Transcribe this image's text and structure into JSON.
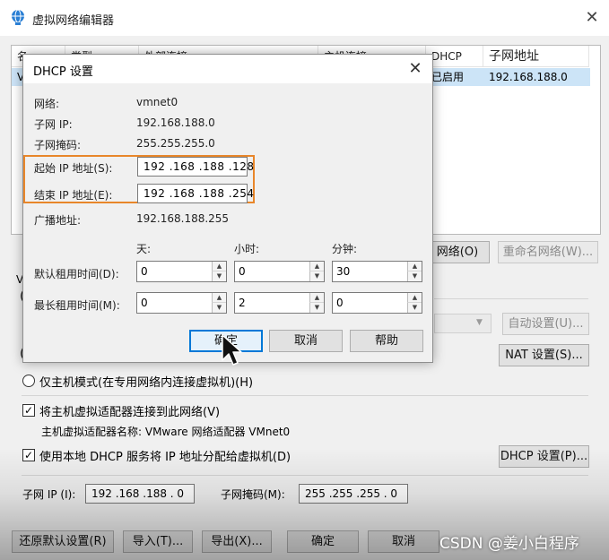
{
  "main_window": {
    "title": "虚拟网络编辑器",
    "close_glyph": "✕",
    "table": {
      "headers": [
        "名",
        "类型",
        "外部连接",
        "主机连接",
        "DHCP",
        "子网地址"
      ],
      "row": {
        "name": "V",
        "dhcp": "已启用",
        "subnet": "192.168.188.0"
      }
    },
    "buttons": {
      "add_network": "网络(O)",
      "rename_network": "重命名网络(W)...",
      "auto_settings": "自动设置(U)...",
      "nat_settings": "NAT 设置(S)...",
      "dhcp_settings": "DHCP 设置(P)...",
      "restore_defaults": "还原默认设置(R)",
      "import": "导入(T)...",
      "export": "导出(X)...",
      "ok": "确定",
      "cancel": "取消"
    },
    "left_partial": {
      "v": "V",
      "paren1": "(",
      "paren2": "("
    },
    "host_only_label": "仅主机模式(在专用网络内连接虚拟机)(H)",
    "connect_adapter_label": "将主机虚拟适配器连接到此网络(V)",
    "adapter_name_text": "主机虚拟适配器名称: VMware 网络适配器 VMnet0",
    "use_dhcp_label": "使用本地 DHCP 服务将 IP 地址分配给虚拟机(D)",
    "subnet_ip_label": "子网 IP (I):",
    "subnet_ip_value": "192 .168 .188 .  0",
    "subnet_mask_label": "子网掩码(M):",
    "subnet_mask_value": "255 .255 .255 .  0"
  },
  "dhcp_dialog": {
    "title": "DHCP 设置",
    "close_glyph": "✕",
    "network_label": "网络:",
    "network_value": "vmnet0",
    "subnet_ip_label": "子网 IP:",
    "subnet_ip_value": "192.168.188.0",
    "subnet_mask_label": "子网掩码:",
    "subnet_mask_value": "255.255.255.0",
    "start_ip_label": "起始 IP 地址(S):",
    "start_ip_value": "192 .168 .188 .128",
    "end_ip_label": "结束 IP 地址(E):",
    "end_ip_value": "192 .168 .188 .254",
    "broadcast_label": "广播地址:",
    "broadcast_value": "192.168.188.255",
    "col_days": "天:",
    "col_hours": "小时:",
    "col_minutes": "分钟:",
    "default_lease_label": "默认租用时间(D):",
    "default_lease": {
      "days": "0",
      "hours": "0",
      "minutes": "30"
    },
    "max_lease_label": "最长租用时间(M):",
    "max_lease": {
      "days": "0",
      "hours": "2",
      "minutes": "0"
    },
    "ok": "确定",
    "cancel": "取消",
    "help": "帮助",
    "spin_up": "▲",
    "spin_down": "▼"
  },
  "watermark": "CSDN @姜小白程序",
  "colors": {
    "highlight": "#e8862a",
    "selection": "#cce4f7",
    "default_button_border": "#0078d7"
  }
}
